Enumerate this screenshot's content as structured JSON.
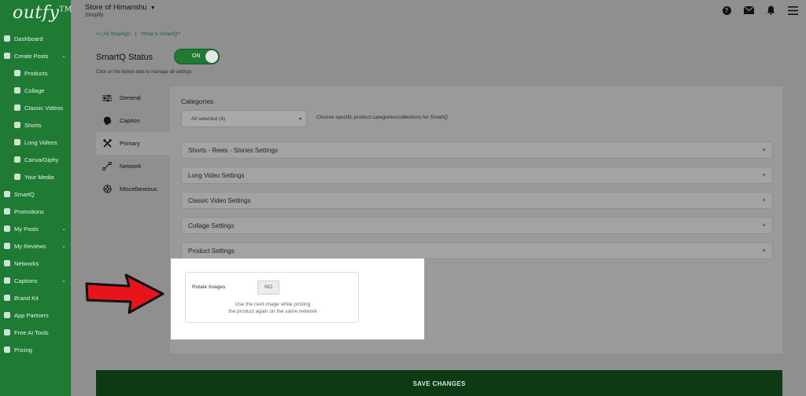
{
  "app": {
    "logo": "outfy",
    "logo_mark": "TM"
  },
  "sidebar": {
    "items": [
      {
        "label": "Dashboard",
        "level": "top",
        "icon": "speedometer-icon"
      },
      {
        "label": "Create Posts",
        "level": "top",
        "icon": "pencil-icon",
        "chevron": "⌄"
      },
      {
        "label": "Products",
        "level": "sub",
        "icon": "tag-icon"
      },
      {
        "label": "Collage",
        "level": "sub",
        "icon": "collage-icon"
      },
      {
        "label": "Classic Videos",
        "level": "sub",
        "icon": "play-icon"
      },
      {
        "label": "Shorts",
        "level": "sub",
        "icon": "shorts-icon"
      },
      {
        "label": "Long Videos",
        "level": "sub",
        "icon": "video-icon"
      },
      {
        "label": "Canva/Giphy",
        "level": "sub",
        "icon": "canva-icon"
      },
      {
        "label": "Your Media",
        "level": "sub",
        "icon": "media-icon"
      },
      {
        "label": "SmartQ",
        "level": "top",
        "icon": "smartq-icon"
      },
      {
        "label": "Promotions",
        "level": "top",
        "icon": "promotions-icon"
      },
      {
        "label": "My Posts",
        "level": "top",
        "icon": "posts-icon",
        "chevron": "⌄"
      },
      {
        "label": "My Reviews",
        "level": "top",
        "icon": "star-icon",
        "chevron": "⌄"
      },
      {
        "label": "Networks",
        "level": "top",
        "icon": "wifi-icon"
      },
      {
        "label": "Captions",
        "level": "top",
        "icon": "captions-icon",
        "chevron": "⌄"
      },
      {
        "label": "Brand Kit",
        "level": "top",
        "icon": "brand-kit-icon"
      },
      {
        "label": "App Partners",
        "level": "top",
        "icon": "partners-icon"
      },
      {
        "label": "Free AI Tools",
        "level": "top",
        "icon": "gear-icon"
      },
      {
        "label": "Pricing",
        "level": "top",
        "icon": "pricing-icon"
      }
    ]
  },
  "header": {
    "store_name": "Store of Himanshu",
    "store_caret": "▼",
    "platform": "Shopify",
    "icons": [
      "help-icon",
      "mail-icon",
      "bell-icon",
      "menu-icon"
    ]
  },
  "breadcrumbs": {
    "back": "<< All SmartQs",
    "separator": "|",
    "info": "What is SmartQ?"
  },
  "smartq": {
    "status_label": "SmartQ Status",
    "toggle_value": "ON",
    "hint": "Click on the below tabs to manage all settings"
  },
  "tabs": [
    {
      "label": "General",
      "icon": "sliders-icon"
    },
    {
      "label": "Caption",
      "icon": "caption-head-icon"
    },
    {
      "label": "Primary",
      "icon": "tools-icon",
      "active": true
    },
    {
      "label": "Network",
      "icon": "network-icon"
    },
    {
      "label": "Miscellaneous",
      "icon": "misc-icon"
    }
  ],
  "categories": {
    "label": "Categories",
    "selected": "All selected (4)",
    "caret": "▾",
    "description": "Choose specific product categories/collections for SmartQ"
  },
  "accordions": [
    {
      "label": "Shorts - Reels - Stories Settings",
      "symbol": "+"
    },
    {
      "label": "Long Video Settings",
      "symbol": "+"
    },
    {
      "label": "Classic Video Settings",
      "symbol": "+"
    },
    {
      "label": "Collage Settings",
      "symbol": "+"
    },
    {
      "label": "Product Settings",
      "symbol": "+"
    }
  ],
  "product_settings": {
    "rotate_label": "Rotate Images",
    "rotate_value": "NO",
    "description_line1": "Use the next image while posting",
    "description_line2": "the product again on the same network"
  },
  "footer": {
    "save_label": "SAVE CHANGES"
  },
  "colors": {
    "brand_green": "#1f7a34",
    "save_bar": "#0d3a14",
    "arrow_red": "#e8141c"
  }
}
